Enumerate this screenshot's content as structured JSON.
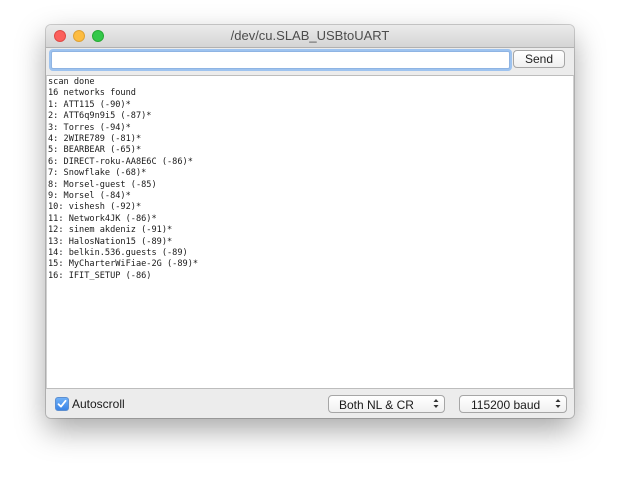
{
  "window": {
    "title": "/dev/cu.SLAB_USBtoUART"
  },
  "input": {
    "value": "",
    "placeholder": ""
  },
  "send_button": {
    "label": "Send"
  },
  "output": {
    "lines": [
      "scan done",
      "16 networks found",
      "1: ATT115 (-90)*",
      "2: ATT6q9n9i5 (-87)*",
      "3: Torres (-94)*",
      "4: 2WIRE789 (-81)*",
      "5: BEARBEAR (-65)*",
      "6: DIRECT-roku-AA8E6C (-86)*",
      "7: Snowflake (-68)*",
      "8: Morsel-guest (-85)",
      "9: Morsel (-84)*",
      "10: vishesh (-92)*",
      "11: Network4JK (-86)*",
      "12: sinem akdeniz (-91)*",
      "13: HalosNation15 (-89)*",
      "14: belkin.536.guests (-89)",
      "15: MyCharterWiFiae-2G (-89)*",
      "16: IFIT_SETUP (-86)"
    ]
  },
  "bottom": {
    "autoscroll_label": "Autoscroll",
    "autoscroll_checked": true,
    "line_ending": "Both NL & CR",
    "baud_rate": "115200 baud"
  },
  "icons": {
    "checkbox": "checkmark-icon",
    "select_arrows": "up-down-arrows-icon"
  },
  "colors": {
    "close": "#fc605c",
    "minimize": "#fdbc40",
    "maximize": "#34c84a",
    "focus_ring": "#9ec3ef",
    "checkbox": "#3a84e6"
  }
}
